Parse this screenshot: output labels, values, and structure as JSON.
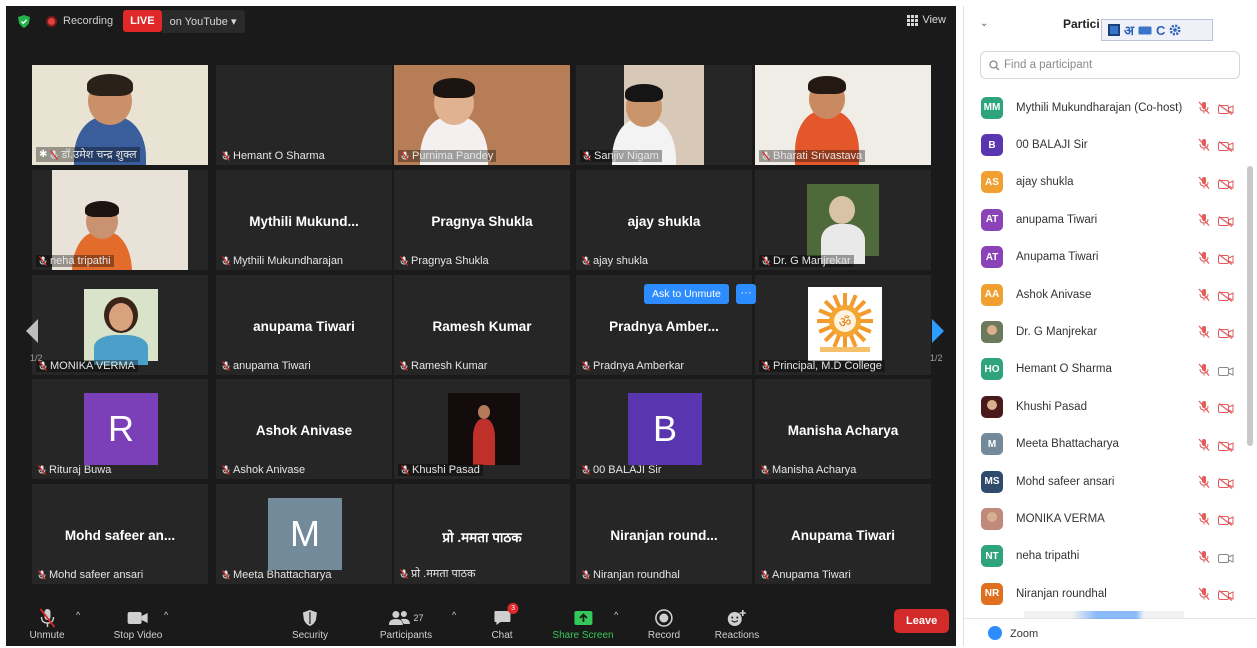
{
  "topbar": {
    "recording_label": "Recording",
    "live_label": "LIVE",
    "stream_label": "on YouTube ▾",
    "view_label": "View"
  },
  "tiles": [
    {
      "name": "डॉ.उमेश चन्द्र शुक्ल",
      "big": "",
      "kind": "video",
      "active": true
    },
    {
      "name": "Hemant O Sharma",
      "big": "",
      "kind": "blank"
    },
    {
      "name": "Purnima Pandey",
      "big": "",
      "kind": "video"
    },
    {
      "name": "Sanjiv Nigam",
      "big": "",
      "kind": "video"
    },
    {
      "name": "Bharati Srivastava",
      "big": "",
      "kind": "video"
    },
    {
      "name": "neha tripathi",
      "big": "",
      "kind": "video"
    },
    {
      "name": "Mythili Mukundharajan",
      "big": "Mythili Mukund...",
      "kind": "text"
    },
    {
      "name": "Pragnya Shukla",
      "big": "Pragnya Shukla",
      "kind": "text"
    },
    {
      "name": "ajay shukla",
      "big": "ajay shukla",
      "kind": "text"
    },
    {
      "name": "Dr. G Manjrekar",
      "big": "",
      "kind": "photo"
    },
    {
      "name": "MONIKA VERMA",
      "big": "",
      "kind": "photo"
    },
    {
      "name": "anupama Tiwari",
      "big": "anupama Tiwari",
      "kind": "text"
    },
    {
      "name": "Ramesh Kumar",
      "big": "Ramesh Kumar",
      "kind": "text"
    },
    {
      "name": "Pradnya Amberkar",
      "big": "Pradnya Amber...",
      "kind": "text"
    },
    {
      "name": "Principal, M.D College",
      "big": "",
      "kind": "logo"
    },
    {
      "name": "Rituraj Buwa",
      "big": "",
      "kind": "avatar",
      "letter": "R",
      "color": "#7b3fb8"
    },
    {
      "name": "Ashok Anivase",
      "big": "Ashok Anivase",
      "kind": "text"
    },
    {
      "name": "Khushi Pasad",
      "big": "",
      "kind": "photo"
    },
    {
      "name": "00 BALAJI Sir",
      "big": "",
      "kind": "avatar",
      "letter": "B",
      "color": "#5a35b0"
    },
    {
      "name": "Manisha Acharya",
      "big": "Manisha Acharya",
      "kind": "text"
    },
    {
      "name": "Mohd safeer ansari",
      "big": "Mohd safeer an...",
      "kind": "text"
    },
    {
      "name": "Meeta Bhattacharya",
      "big": "",
      "kind": "avatar",
      "letter": "M",
      "color": "#738a9a"
    },
    {
      "name": "प्रो .ममता पाठक",
      "big": "प्रो .ममता पाठक",
      "kind": "text"
    },
    {
      "name": "Niranjan  roundhal",
      "big": "Niranjan  round...",
      "kind": "text"
    },
    {
      "name": "Anupama Tiwari",
      "big": "Anupama Tiwari",
      "kind": "text"
    }
  ],
  "ask_to_unmute": "Ask to Unmute",
  "ask_more": "···",
  "pagination": {
    "left": "1/2",
    "right": "1/2"
  },
  "toolbar": {
    "unmute": "Unmute",
    "stop_video": "Stop Video",
    "security": "Security",
    "participants": "Participants",
    "participants_count": "27",
    "chat": "Chat",
    "chat_badge": "3",
    "share_screen": "Share Screen",
    "record": "Record",
    "reactions": "Reactions",
    "leave": "Leave"
  },
  "panel": {
    "title": "Partici",
    "ime": "अ",
    "ime_c": "C",
    "search_placeholder": "Find a participant",
    "participants": [
      {
        "initials": "MM",
        "name": "Mythili Mukundharajan (Co-host)",
        "color": "#2fa37b",
        "cam": "off"
      },
      {
        "initials": "B",
        "name": "00 BALAJI Sir",
        "color": "#5a35b0",
        "cam": "off"
      },
      {
        "initials": "AS",
        "name": "ajay shukla",
        "color": "#f0a030",
        "cam": "off"
      },
      {
        "initials": "AT",
        "name": "anupama Tiwari",
        "color": "#8b44b8",
        "cam": "off"
      },
      {
        "initials": "AT",
        "name": "Anupama Tiwari",
        "color": "#8b44b8",
        "cam": "off"
      },
      {
        "initials": "AA",
        "name": "Ashok Anivase",
        "color": "#f0a030",
        "cam": "off"
      },
      {
        "initials": "",
        "name": "Dr. G Manjrekar",
        "color": "#6b7a5a",
        "cam": "off"
      },
      {
        "initials": "HO",
        "name": "Hemant O Sharma",
        "color": "#2fa37b",
        "cam": "on"
      },
      {
        "initials": "",
        "name": "Khushi Pasad",
        "color": "#4a1a1a",
        "cam": "off"
      },
      {
        "initials": "M",
        "name": "Meeta Bhattacharya",
        "color": "#738a9a",
        "cam": "off"
      },
      {
        "initials": "MS",
        "name": "Mohd safeer ansari",
        "color": "#2f4a6a",
        "cam": "off"
      },
      {
        "initials": "",
        "name": "MONIKA VERMA",
        "color": "#c08a7a",
        "cam": "off"
      },
      {
        "initials": "NT",
        "name": "neha tripathi",
        "color": "#2fa37b",
        "cam": "on"
      },
      {
        "initials": "NR",
        "name": "Niranjan  roundhal",
        "color": "#e07020",
        "cam": "off"
      }
    ],
    "footer": "Zoom"
  }
}
